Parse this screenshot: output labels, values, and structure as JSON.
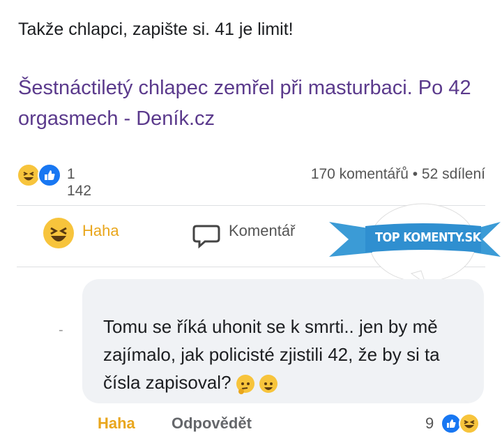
{
  "post": {
    "text": "Takže chlapci, zapište si. 41 je limit!",
    "link_title": "Šestnáctiletý chlapec zemřel při masturbaci. Po 42 orgasmech - Deník.cz"
  },
  "stats": {
    "reaction_count": "1 142",
    "comments_shares": "170 komentářů • 52 sdílení"
  },
  "actions": {
    "haha_label": "Haha",
    "comment_label": "Komentář"
  },
  "badge": {
    "text": "TOP KOMENTY.SK"
  },
  "comment": {
    "text": "Tomu se říká uhonit se k smrti.. jen by mě zajímalo, jak policisté zjistili 42, že by si ta čísla zapisoval?",
    "haha_label": "Haha",
    "reply_label": "Odpovědět",
    "reaction_count": "9"
  },
  "colors": {
    "link": "#5b3a8c",
    "haha": "#f7c43c",
    "like": "#1877f2",
    "badge": "#3b9bd6"
  },
  "icons": [
    "haha-emoji-icon",
    "like-icon",
    "comment-icon",
    "thinking-emoji-icon",
    "smile-emoji-icon"
  ]
}
